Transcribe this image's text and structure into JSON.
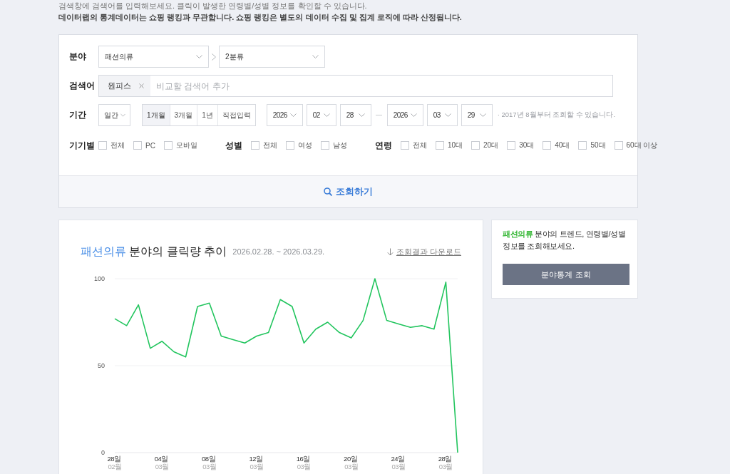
{
  "notices": [
    {
      "kind": "info",
      "text": "검색창에 검색어를 입력해보세요. 클릭이 발생한 연령별/성별 정보를 확인할 수 있습니다."
    },
    {
      "kind": "disclaimer",
      "text": "데이터랩의 통계데이터는 쇼핑 랭킹과 무관합니다. 쇼핑 랭킹은 별도의 데이터 수집 및 집계 로직에 따라 산정됩니다."
    }
  ],
  "filters": {
    "category": {
      "label": "분야",
      "first": "패션의류",
      "second": "2분류"
    },
    "keyword": {
      "label": "검색어",
      "tags": [
        "원피스"
      ],
      "placeholder": "비교할 검색어 추가"
    },
    "period": {
      "label": "기간",
      "unit": "일간",
      "ranges": [
        {
          "label": "1개월",
          "selected": true
        },
        {
          "label": "3개월",
          "selected": false
        },
        {
          "label": "1년",
          "selected": false
        },
        {
          "label": "직접입력",
          "selected": false
        }
      ],
      "start": {
        "year": "2026",
        "month": "02",
        "day": "28"
      },
      "end": {
        "year": "2026",
        "month": "03",
        "day": "29"
      },
      "note": "· 2017년 8월부터 조회할 수 있습니다."
    },
    "options": [
      {
        "label": "기기별",
        "items": [
          {
            "label": "전체",
            "checked": false
          },
          {
            "label": "PC",
            "checked": false
          },
          {
            "label": "모바일",
            "checked": false
          }
        ]
      },
      {
        "label": "성별",
        "items": [
          {
            "label": "전체",
            "checked": false
          },
          {
            "label": "여성",
            "checked": false
          },
          {
            "label": "남성",
            "checked": false
          }
        ]
      },
      {
        "label": "연령",
        "items": [
          {
            "label": "전체",
            "checked": false
          },
          {
            "label": "10대",
            "checked": false
          },
          {
            "label": "20대",
            "checked": false
          },
          {
            "label": "30대",
            "checked": false
          },
          {
            "label": "40대",
            "checked": false
          },
          {
            "label": "50대",
            "checked": false
          },
          {
            "label": "60대 이상",
            "checked": false
          }
        ]
      }
    ],
    "search_button": "조회하기"
  },
  "trend": {
    "title_highlight": "패션의류",
    "title": "분야의 클릭량 추이",
    "date_range": "2026.02.28. ~ 2026.03.29.",
    "download_link": "조회결과 다운로드",
    "chart_data": {
      "type": "line",
      "x": [
        "2026-02-28",
        "2026-03-01",
        "2026-03-02",
        "2026-03-03",
        "2026-03-04",
        "2026-03-05",
        "2026-03-06",
        "2026-03-07",
        "2026-03-08",
        "2026-03-09",
        "2026-03-10",
        "2026-03-11",
        "2026-03-12",
        "2026-03-13",
        "2026-03-14",
        "2026-03-15",
        "2026-03-16",
        "2026-03-17",
        "2026-03-18",
        "2026-03-19",
        "2026-03-20",
        "2026-03-21",
        "2026-03-22",
        "2026-03-23",
        "2026-03-24",
        "2026-03-25",
        "2026-03-26",
        "2026-03-27",
        "2026-03-28",
        "2026-03-29"
      ],
      "xlim": [
        "2026-02-28",
        "2026-03-29"
      ],
      "ylim": [
        0,
        100
      ],
      "yticks": [
        0,
        50,
        100
      ],
      "xticks": [
        {
          "value": "2026-02-28",
          "label": "28일\n02월"
        },
        {
          "value": "2026-03-04",
          "label": "04일\n03월"
        },
        {
          "value": "2026-03-08",
          "label": "08일\n03월"
        },
        {
          "value": "2026-03-12",
          "label": "12일\n03월"
        },
        {
          "value": "2026-03-16",
          "label": "16일\n03월"
        },
        {
          "value": "2026-03-20",
          "label": "20일\n03월"
        },
        {
          "value": "2026-03-24",
          "label": "24일\n03월"
        },
        {
          "value": "2026-03-28",
          "label": "28일\n03월"
        }
      ],
      "series": [
        {
          "color": "#22c55e",
          "values": [
            77,
            73,
            85,
            60,
            64,
            58,
            55,
            84,
            86,
            67,
            65,
            63,
            67,
            69,
            88,
            84,
            63,
            71,
            75,
            69,
            66,
            76,
            100,
            76,
            74,
            72,
            73,
            71,
            98,
            0
          ]
        }
      ]
    }
  },
  "side_panel": {
    "highlight": "패션의류",
    "text": "분야의 트렌드, 연령별/성별 정보를 조회해보세요.",
    "button": "분야통계 조회"
  }
}
